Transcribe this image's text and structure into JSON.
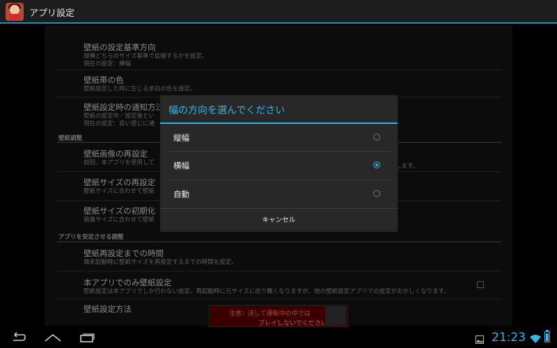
{
  "actionbar": {
    "title": "アプリ設定"
  },
  "settings": {
    "items": [
      {
        "title": "壁紙の設定基準方向",
        "summary1": "縦横どちらのサイズ基準で拡縮するかを設定。",
        "summary2": "現在の設定：横幅"
      },
      {
        "title": "壁紙帯の色",
        "summary1": "壁紙設定した時に生じる余白の色を設定。"
      },
      {
        "title": "壁紙設定時の通知方法",
        "summary1": "壁紙の設定中／設定後とい",
        "summary2": "現在の設定：良い感じに通"
      },
      {
        "title": "壁紙画像の再設定",
        "summary1": "前回、本アプリを使用して",
        "summary1_right": "します。"
      },
      {
        "title": "壁紙サイズの再設定",
        "summary1": "壁紙サイズに合わせて壁紙"
      },
      {
        "title": "壁紙サイズの初期化",
        "summary1": "画像サイズに合わせて壁紙"
      },
      {
        "title": "壁紙再設定までの時間",
        "summary1": "端末起動時に壁紙サイズを再設定するまでの時間を設定。"
      },
      {
        "title": "本アプリでのみ壁紙設定",
        "summary1": "壁紙設定は本アプリでしか行わない設定。再起動時に元サイズに戻り難くなりますが、他の壁紙設定アプリでの設定がおかしくなります。"
      },
      {
        "title": "壁紙設定方法"
      }
    ],
    "categories": [
      {
        "label": "壁紙調整"
      },
      {
        "label": "アプリを安定させる調整"
      }
    ]
  },
  "dialog": {
    "title": "幅の方向を選んでください",
    "options": [
      {
        "label": "縦幅",
        "selected": false
      },
      {
        "label": "横幅",
        "selected": true
      },
      {
        "label": "自動",
        "selected": false
      }
    ],
    "cancel_label": "キャンセル"
  },
  "ad": {
    "line1": "注意：決して運転中の中では",
    "line2": "プレイしないでください"
  },
  "statusbar": {
    "time": "21:23"
  },
  "colors": {
    "accent": "#33b5e5"
  }
}
